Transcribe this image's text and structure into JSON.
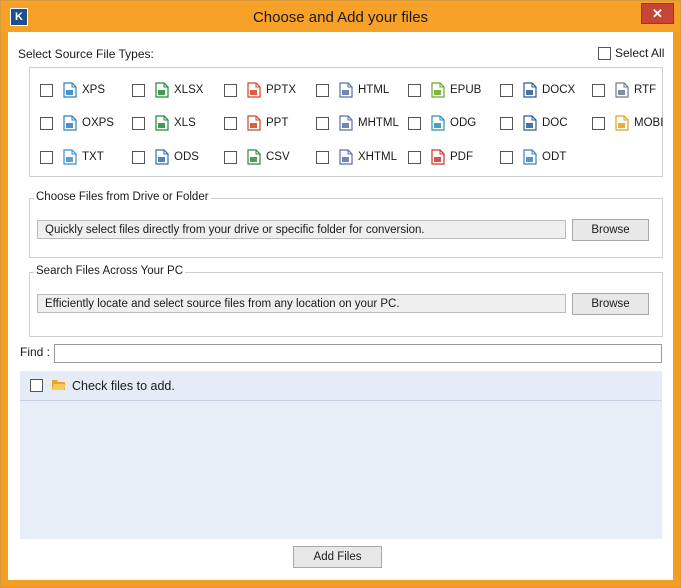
{
  "window": {
    "title": "Choose and Add your files",
    "app_icon_letter": "K",
    "close_glyph": "✕"
  },
  "file_types": {
    "label": "Select Source File Types:",
    "select_all_label": "Select All",
    "items": [
      {
        "label": "XPS",
        "icon": "xps-icon",
        "color": "#2f7fc1"
      },
      {
        "label": "XLSX",
        "icon": "excel-icon",
        "color": "#1e8a3a"
      },
      {
        "label": "PPTX",
        "icon": "powerpoint-icon",
        "color": "#d04423"
      },
      {
        "label": "HTML",
        "icon": "html-code-icon",
        "color": "#5a6fa8"
      },
      {
        "label": "EPUB",
        "icon": "epub-icon",
        "color": "#6aa82a"
      },
      {
        "label": "DOCX",
        "icon": "word-icon",
        "color": "#2b5797"
      },
      {
        "label": "RTF",
        "icon": "rtf-icon",
        "color": "#6b7a90"
      },
      {
        "label": "OXPS",
        "icon": "oxps-icon",
        "color": "#2f7fc1"
      },
      {
        "label": "XLS",
        "icon": "excel-icon",
        "color": "#1e8a3a"
      },
      {
        "label": "PPT",
        "icon": "powerpoint-icon",
        "color": "#d04423"
      },
      {
        "label": "MHTML",
        "icon": "mhtml-code-icon",
        "color": "#5a6fa8"
      },
      {
        "label": "ODG",
        "icon": "odg-icon",
        "color": "#2a8fb0"
      },
      {
        "label": "DOC",
        "icon": "word-icon",
        "color": "#2b5797"
      },
      {
        "label": "MOBI",
        "icon": "mobi-icon",
        "color": "#e0a21a"
      },
      {
        "label": "TXT",
        "icon": "text-icon",
        "color": "#3a8fd0"
      },
      {
        "label": "ODS",
        "icon": "ods-icon",
        "color": "#2f6fb8"
      },
      {
        "label": "CSV",
        "icon": "csv-icon",
        "color": "#2e8b3a"
      },
      {
        "label": "XHTML",
        "icon": "xhtml-code-icon",
        "color": "#5a6fa8"
      },
      {
        "label": "PDF",
        "icon": "pdf-icon",
        "color": "#d0312d"
      },
      {
        "label": "ODT",
        "icon": "odt-icon",
        "color": "#3a7fc8"
      }
    ]
  },
  "drive_group": {
    "title": "Choose Files from Drive or Folder",
    "text": "Quickly select files directly from your drive or specific folder for conversion.",
    "button": "Browse"
  },
  "search_group": {
    "title": "Search Files Across Your PC",
    "text": "Efficiently locate and select source files from any location on your PC.",
    "button": "Browse"
  },
  "find": {
    "label": "Find :",
    "value": ""
  },
  "tree": {
    "root_label": "Check files to add."
  },
  "footer": {
    "add_button": "Add Files"
  }
}
